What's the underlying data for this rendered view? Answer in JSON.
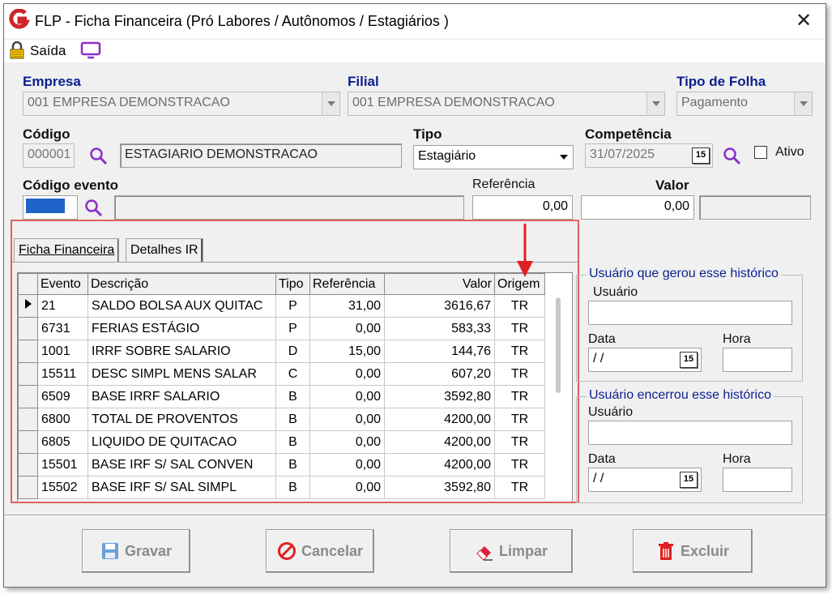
{
  "window": {
    "title": "FLP - Ficha Financeira (Pró Labores / Autônomos / Estagiários )"
  },
  "toolbar": {
    "exit_label": "Saída"
  },
  "form": {
    "empresa_label": "Empresa",
    "empresa_value": "001 EMPRESA DEMONSTRACAO",
    "filial_label": "Filial",
    "filial_value": "001 EMPRESA DEMONSTRACAO",
    "tipo_folha_label": "Tipo de Folha",
    "tipo_folha_value": "Pagamento",
    "codigo_label": "Código",
    "codigo_value": "000001",
    "nome_value": "ESTAGIARIO DEMONSTRACAO",
    "tipo_label": "Tipo",
    "tipo_value": "Estagiário",
    "competencia_label": "Competência",
    "competencia_value": "31/07/2025",
    "ativo_label": "Ativo",
    "codigo_evento_label": "Código evento",
    "referencia_label": "Referência",
    "referencia_value": "0,00",
    "valor_label": "Valor",
    "valor_value": "0,00",
    "calendar_glyph": "15"
  },
  "tabs": [
    {
      "label": "Ficha Financeira",
      "active": true
    },
    {
      "label": "Detalhes IR",
      "active": false
    }
  ],
  "grid": {
    "columns": [
      "Evento",
      "Descrição",
      "Tipo",
      "Referência",
      "Valor",
      "Origem"
    ],
    "rows": [
      [
        "21",
        "SALDO BOLSA AUX QUITAC",
        "P",
        "31,00",
        "3616,67",
        "TR"
      ],
      [
        "6731",
        "FERIAS ESTÁGIO",
        "P",
        "0,00",
        "583,33",
        "TR"
      ],
      [
        "1001",
        "IRRF SOBRE SALARIO",
        "D",
        "15,00",
        "144,76",
        "TR"
      ],
      [
        "15511",
        "DESC SIMPL MENS SALAR",
        "C",
        "0,00",
        "607,20",
        "TR"
      ],
      [
        "6509",
        "BASE IRRF SALARIO",
        "B",
        "0,00",
        "3592,80",
        "TR"
      ],
      [
        "6800",
        "TOTAL DE PROVENTOS",
        "B",
        "0,00",
        "4200,00",
        "TR"
      ],
      [
        "6805",
        "LIQUIDO DE QUITACAO",
        "B",
        "0,00",
        "4200,00",
        "TR"
      ],
      [
        "15501",
        "BASE IRF S/ SAL CONVEN",
        "B",
        "0,00",
        "4200,00",
        "TR"
      ],
      [
        "15502",
        "BASE IRF S/ SAL SIMPL",
        "B",
        "0,00",
        "3592,80",
        "TR"
      ]
    ]
  },
  "history_created": {
    "title": "Usuário que gerou esse histórico",
    "user_label": "Usuário",
    "date_label": "Data",
    "date_value": " / /",
    "hour_label": "Hora"
  },
  "history_closed": {
    "title": "Usuário encerrou esse histórico",
    "user_label": "Usuário",
    "date_label": "Data",
    "date_value": " / /",
    "hour_label": "Hora"
  },
  "buttons": {
    "save": "Gravar",
    "cancel": "Cancelar",
    "clear": "Limpar",
    "delete": "Excluir"
  },
  "colors": {
    "label_blue": "#0a1f8f",
    "highlight_red": "#e06060",
    "accent_purple": "#8b2fc9",
    "field_blue": "#1e63c8"
  }
}
